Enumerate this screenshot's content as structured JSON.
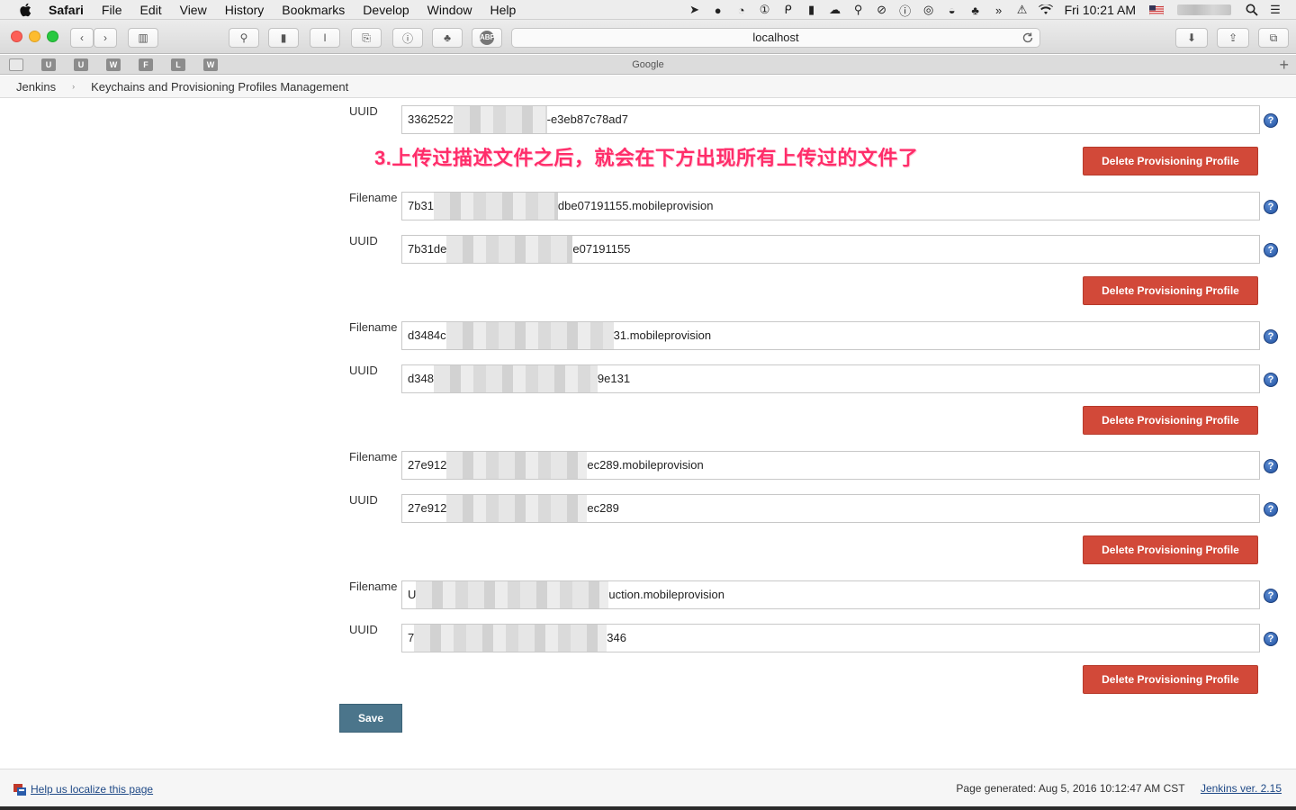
{
  "menubar": {
    "app": "Safari",
    "items": [
      "File",
      "Edit",
      "View",
      "History",
      "Bookmarks",
      "Develop",
      "Window",
      "Help"
    ],
    "clock": "Fri 10:21 AM"
  },
  "toolbar": {
    "url": "localhost"
  },
  "bookmarks": {
    "items": [
      "U",
      "U",
      "W",
      "F",
      "L",
      "W"
    ],
    "tab_title": "Google",
    "new_tab": "+"
  },
  "breadcrumb": {
    "home": "Jenkins",
    "separator": "›",
    "current": "Keychains and Provisioning Profiles Management"
  },
  "annotation": "3.上传过描述文件之后，就会在下方出现所有上传过的文件了",
  "labels": {
    "filename": "Filename",
    "uuid": "UUID",
    "delete": "Delete Provisioning Profile",
    "help": "?"
  },
  "profiles": [
    {
      "uuid_prefix": "3362522",
      "uuid_suffix": "-e3eb87c78ad7"
    },
    {
      "filename_prefix": "7b31",
      "filename_suffix": "dbe07191155.mobileprovision",
      "uuid_prefix": "7b31de",
      "uuid_suffix": "e07191155"
    },
    {
      "filename_prefix": "d3484c",
      "filename_suffix": "31.mobileprovision",
      "uuid_prefix": "d348",
      "uuid_suffix": "9e131"
    },
    {
      "filename_prefix": "27e912",
      "filename_suffix": "ec289.mobileprovision",
      "uuid_prefix": "27e912",
      "uuid_suffix": "ec289"
    },
    {
      "filename_prefix": "U",
      "filename_suffix": "uction.mobileprovision",
      "uuid_prefix": "7",
      "uuid_suffix": "346"
    }
  ],
  "save_label": "Save",
  "footer": {
    "localize_link": "Help us localize this page",
    "generated": "Page generated: Aug 5, 2016 10:12:47 AM CST",
    "version_link": "Jenkins ver. 2.15"
  },
  "colors": {
    "delete_button": "#d24939",
    "save_button": "#4b758b",
    "annotation": "#ff2d6a",
    "link": "#204a87"
  }
}
